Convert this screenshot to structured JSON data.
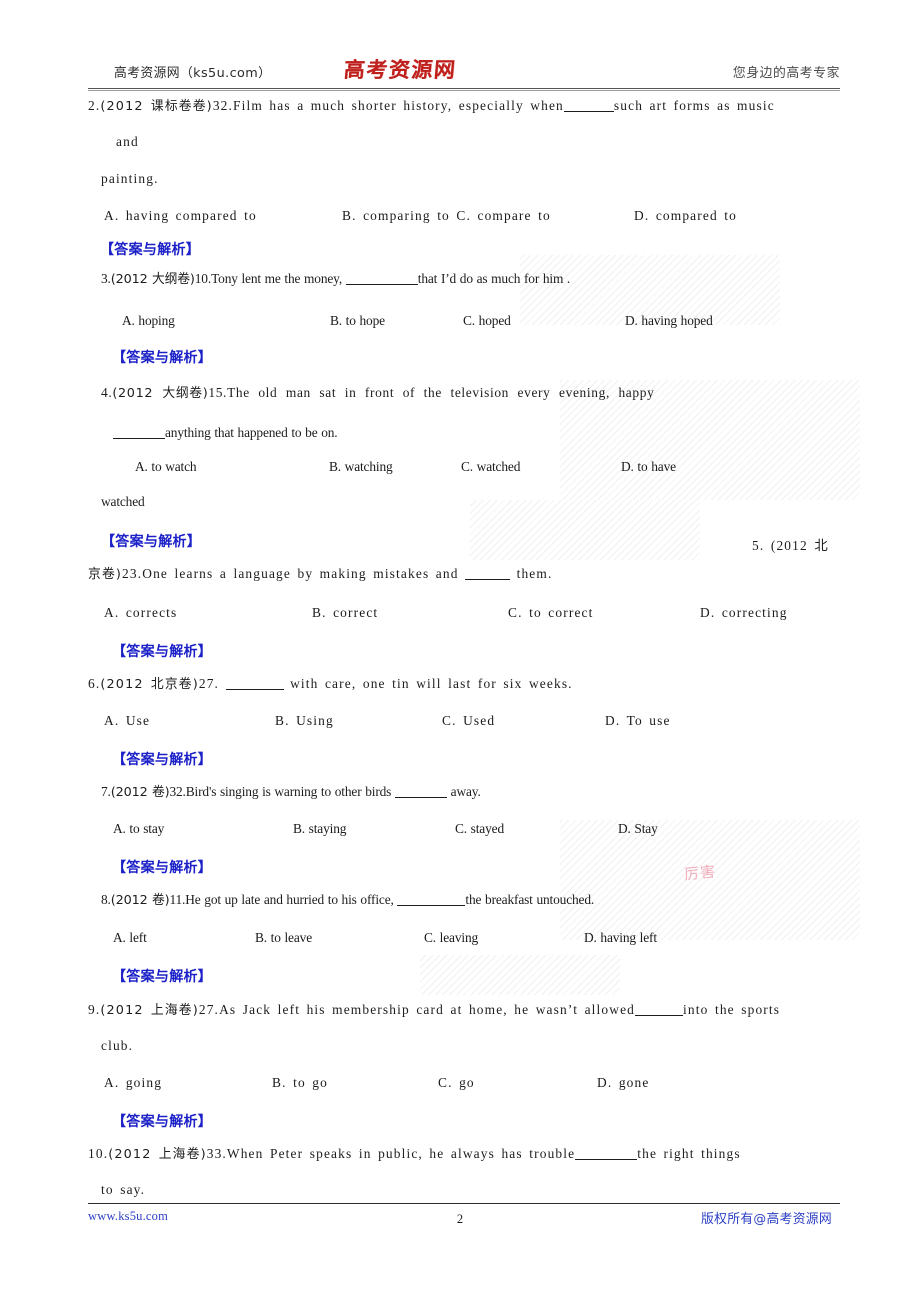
{
  "header": {
    "left": "高考资源网（ks5u.com）",
    "logo": "高考资源网",
    "right": "您身边的高考专家"
  },
  "footer": {
    "site": "www.ks5u.com",
    "page_number": "2",
    "copyright": "版权所有@高考资源网"
  },
  "answer_label": "【答案与解析】",
  "questions": [
    {
      "number": "2.",
      "source": "(2012 课标卷卷)",
      "item": "32.",
      "stem_line1": "Film has a much shorter history, especially when",
      "stem_line1_tail": "such art forms as music",
      "stem_line2": "and",
      "stem_line3": "painting.",
      "options": [
        "A. having compared to",
        "B. comparing to C. compare to",
        "D. compared to"
      ]
    },
    {
      "number": "3.",
      "source": "(2012 大纲卷)",
      "item": "10.",
      "stem_line1": "Tony lent me the money,",
      "stem_line1_tail": "that I’d do as much for him .",
      "options": [
        "A. hoping",
        "B. to hope",
        "C. hoped",
        "D. having hoped"
      ]
    },
    {
      "number": "4.",
      "source": "(2012 大纲卷)",
      "item": "15.",
      "stem_line1": "The old man sat in front of the television every evening, happy",
      "stem_line2_tail": "anything that happened to be on.",
      "options": [
        "A. to watch",
        "B. watching",
        "C. watched",
        "D.    to    have"
      ],
      "options_overflow": "watched"
    },
    {
      "number": "5.",
      "source_head": "5. (2012 北",
      "source_tail": "京卷)",
      "item": "23.",
      "stem_line1": "One learns a language by making mistakes and",
      "stem_line1_tail": "them.",
      "options": [
        "A. corrects",
        "B. correct",
        "C. to correct",
        "D. correcting"
      ]
    },
    {
      "number": "6.",
      "source": "(2012 北京卷)",
      "item": "27.",
      "stem_line1": "",
      "stem_line1_tail": "with care, one tin will last for six weeks.",
      "options": [
        "A. Use",
        "B. Using",
        "C. Used",
        "D. To use"
      ]
    },
    {
      "number": "7.",
      "source": "(2012 卷)",
      "item": "32.",
      "stem_line1": "Bird's singing is warning to other birds",
      "stem_line1_tail": "away.",
      "options": [
        "A. to stay",
        "B. staying",
        "C. stayed",
        "D. Stay"
      ]
    },
    {
      "number": "8.",
      "source": "(2012 卷)",
      "item": "11.",
      "stem_line1": "He got up late and hurried to his office,",
      "stem_line1_tail": "the breakfast untouched.",
      "options": [
        "A. left",
        "B. to leave",
        "C. leaving",
        "D. having left"
      ]
    },
    {
      "number": "9.",
      "source": "(2012 上海卷)",
      "item": "27.",
      "stem_line1": "As Jack left his membership card at home, he wasn’t allowed",
      "stem_line1_tail": "into the sports",
      "stem_line2": "club.",
      "options": [
        "A. going",
        "B. to go",
        "C. go",
        "D. gone"
      ]
    },
    {
      "number": "10.",
      "source": "(2012 上海卷)",
      "item": "33.",
      "stem_line1": "When Peter speaks in public, he always has trouble",
      "stem_line1_tail": "the right things",
      "stem_line2": "to say."
    }
  ]
}
